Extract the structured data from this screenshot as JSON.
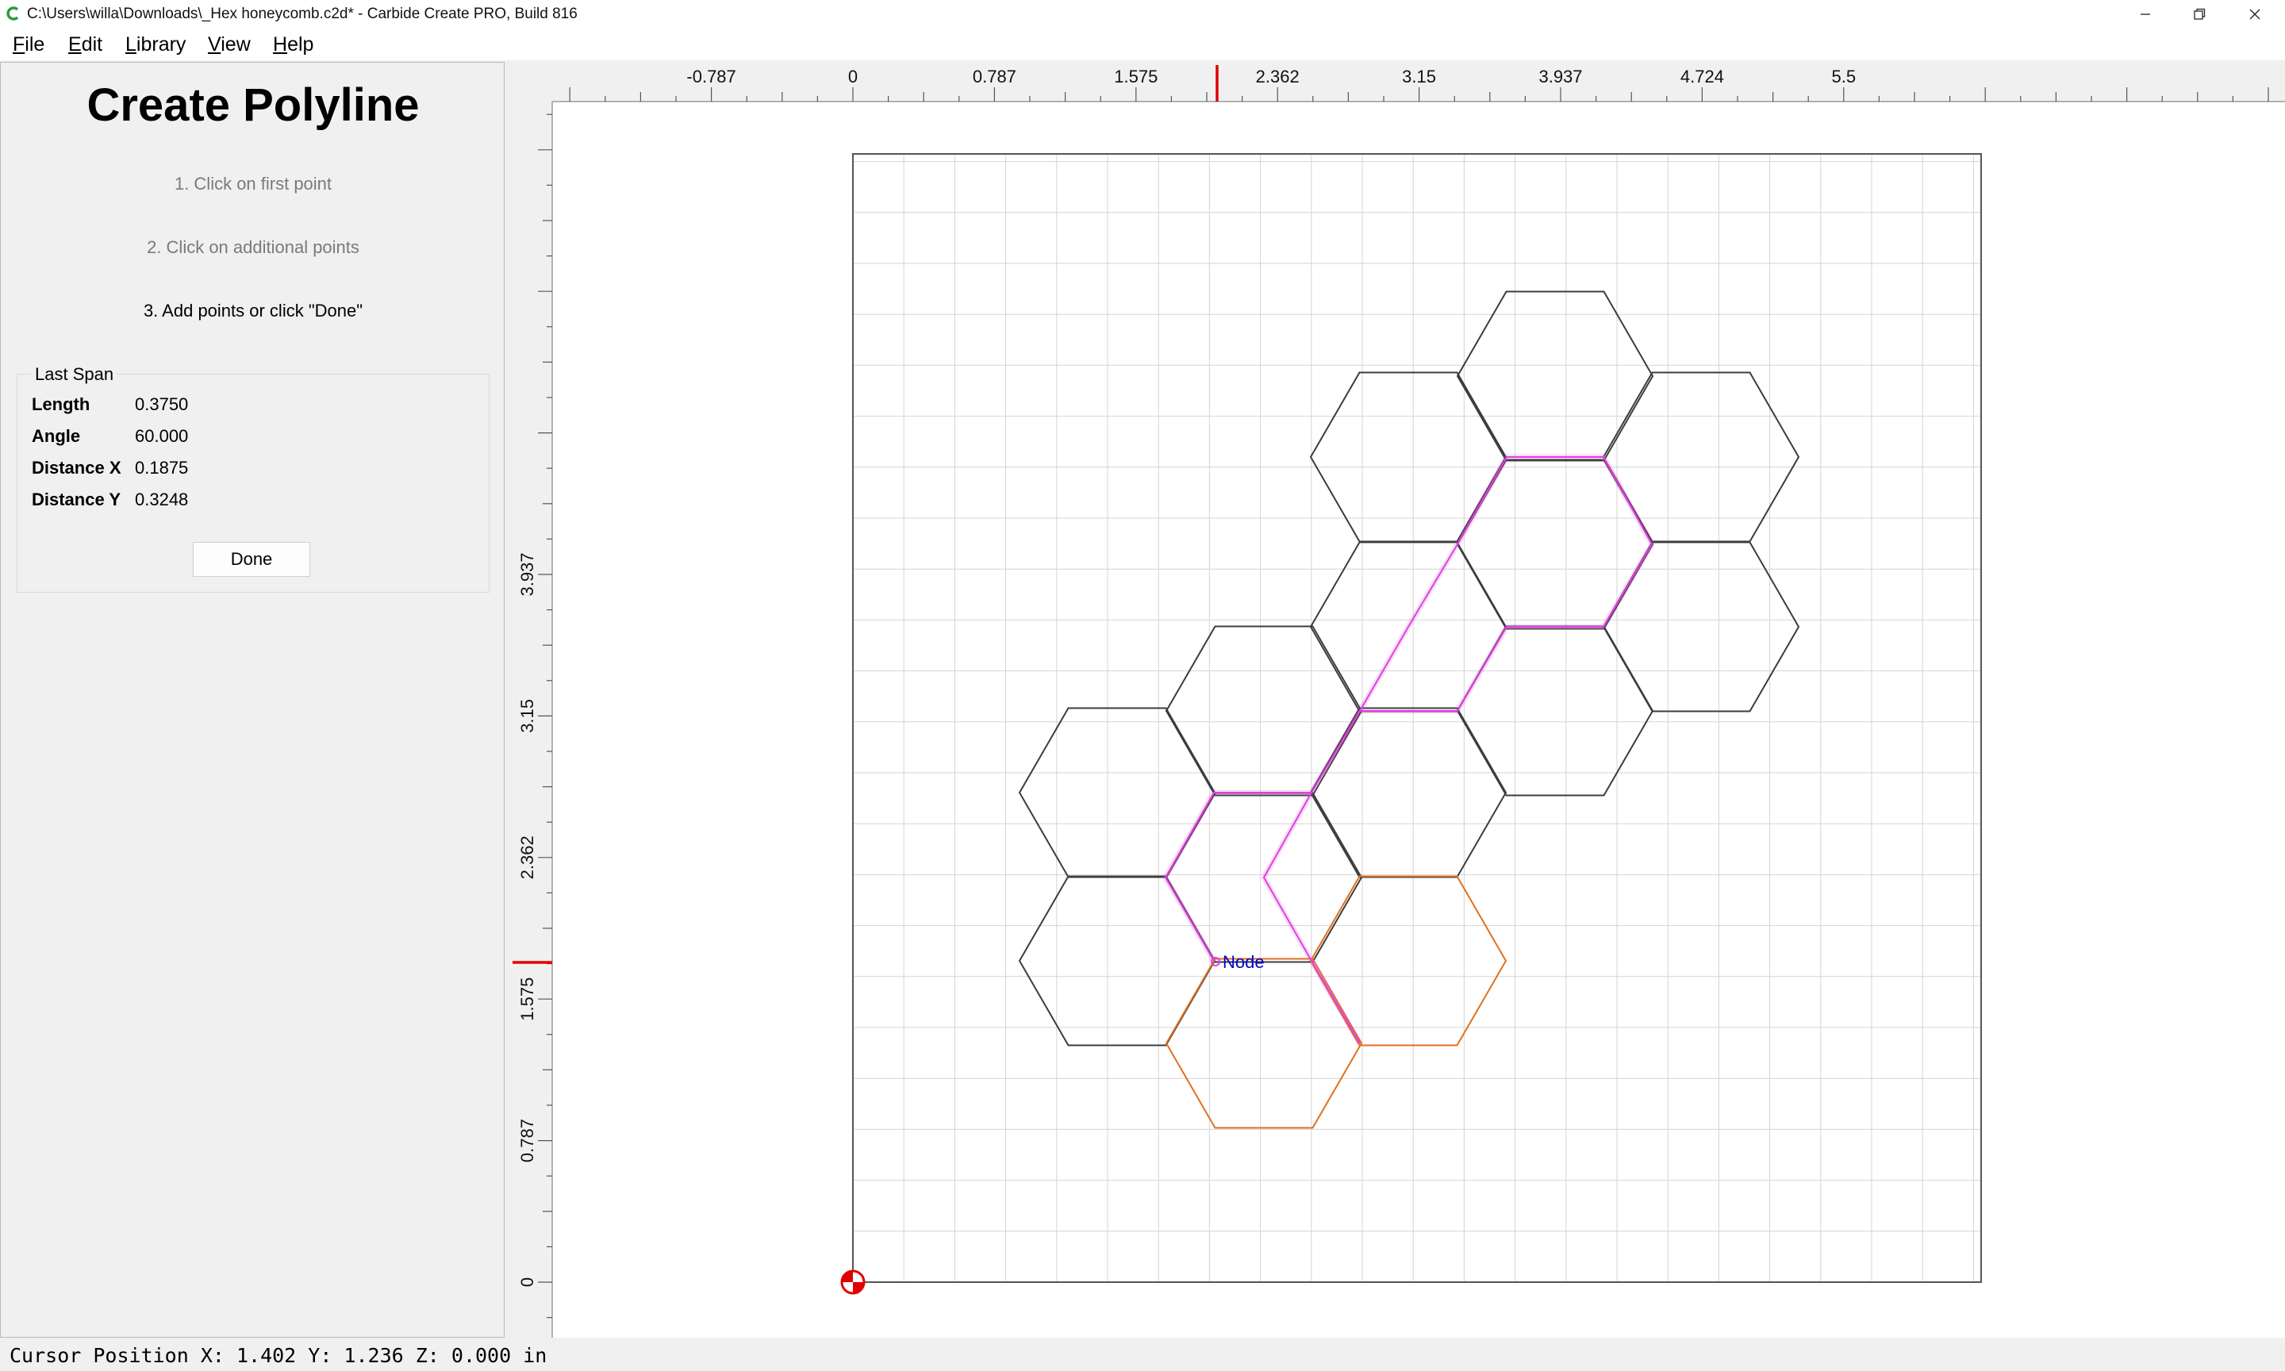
{
  "window": {
    "title": "C:\\Users\\willa\\Downloads\\_Hex honeycomb.c2d* - Carbide Create PRO, Build 816",
    "icon": "carbide-create-icon",
    "controls": [
      "minimize-icon",
      "restore-icon",
      "close-icon"
    ]
  },
  "menu": {
    "items": [
      {
        "label": "File",
        "first": "F",
        "rest": "ile"
      },
      {
        "label": "Edit",
        "first": "E",
        "rest": "dit"
      },
      {
        "label": "Library",
        "first": "L",
        "rest": "ibrary"
      },
      {
        "label": "View",
        "first": "V",
        "rest": "iew"
      },
      {
        "label": "Help",
        "first": "H",
        "rest": "elp"
      }
    ]
  },
  "panel": {
    "title": "Create Polyline",
    "steps": [
      "1. Click on first point",
      "2. Click on additional points",
      "3. Add points or click \"Done\""
    ],
    "last_span": {
      "title": "Last Span",
      "rows": [
        {
          "label": "Length",
          "value": "0.3750"
        },
        {
          "label": "Angle",
          "value": "60.000"
        },
        {
          "label": "Distance X",
          "value": "0.1875"
        },
        {
          "label": "Distance Y",
          "value": "0.3248"
        }
      ]
    },
    "done_label": "Done"
  },
  "rulers": {
    "top_labels": [
      "-0.787",
      "0",
      "0.787",
      "1.575",
      "2.362",
      "3.15",
      "3.937",
      "4.724",
      "5.5"
    ],
    "left_labels": [
      "3.937",
      "3.15",
      "2.362",
      "1.575",
      "0.787",
      "0"
    ],
    "cursor_marker_color": "#e00000"
  },
  "drawing": {
    "node_label": "Node",
    "colors": {
      "hex_default": "#3c3c3c",
      "hex_selected": "#e040e0",
      "hex_new": "#e07020",
      "node_label": "#0000cc",
      "grid": "#d4d4d4",
      "origin": "#e00000"
    }
  },
  "status": {
    "text": "Cursor Position X: 1.402 Y: 1.236 Z: 0.000 in"
  }
}
